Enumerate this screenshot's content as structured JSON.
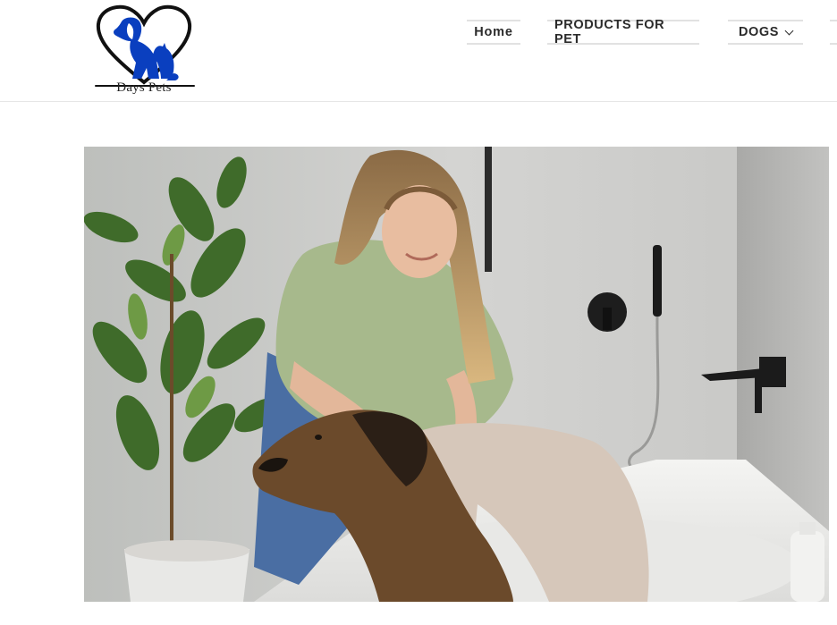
{
  "brand": {
    "name": "Days Pets",
    "logo_color": "#0a3fbf"
  },
  "nav": {
    "items": [
      {
        "label": "Home"
      },
      {
        "label": "PRODUCTS FOR PET"
      },
      {
        "label": "DOGS",
        "has_dropdown": true
      }
    ]
  },
  "hero": {
    "image_icon": "woman-bathing-dog-photo"
  }
}
